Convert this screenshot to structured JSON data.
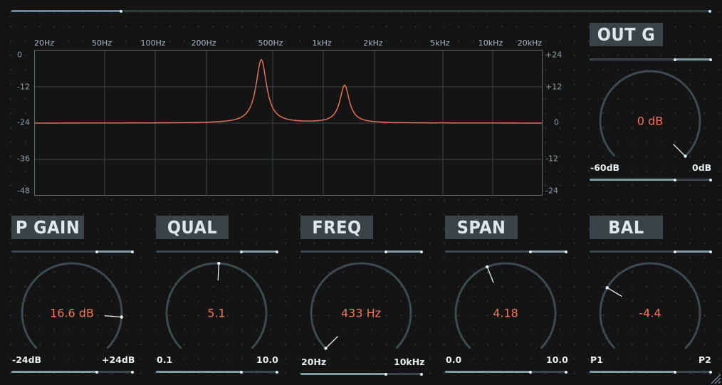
{
  "eq": {
    "freq_labels": [
      "20Hz",
      "50Hz",
      "100Hz",
      "200Hz",
      "500Hz",
      "1kHz",
      "2kHz",
      "5kHz",
      "10kHz",
      "20kHz"
    ],
    "left_db_labels": [
      "0",
      "-12",
      "-24",
      "-36",
      "-48"
    ],
    "right_db_labels": [
      "+24",
      "+12",
      "0",
      "-12",
      "-24"
    ],
    "curve_color": "#f07757"
  },
  "controls": {
    "out_g": {
      "label": "OUT G",
      "value": "0 dB",
      "min": "-60dB",
      "max": "0dB",
      "level": 1.0
    },
    "p_gain": {
      "label": "P GAIN",
      "value": "16.6 dB",
      "min": "-24dB",
      "max": "+24dB",
      "level": 0.85
    },
    "qual": {
      "label": "QUAL",
      "value": "5.1",
      "min": "0.1",
      "max": "10.0",
      "level": 0.51
    },
    "freq": {
      "label": "FREQ",
      "value": "433 Hz",
      "min": "20Hz",
      "max": "10kHz",
      "level": 0.0
    },
    "span": {
      "label": "SPAN",
      "value": "4.18",
      "min": "0.0",
      "max": "10.0",
      "level": 0.42
    },
    "bal": {
      "label": "BAL",
      "value": "-4.4",
      "min": "P1",
      "max": "P2",
      "level": 0.28
    }
  },
  "colors": {
    "accent": "#f07757",
    "knob_track": "#3e4a4e",
    "label_bg": "#3a4345"
  }
}
